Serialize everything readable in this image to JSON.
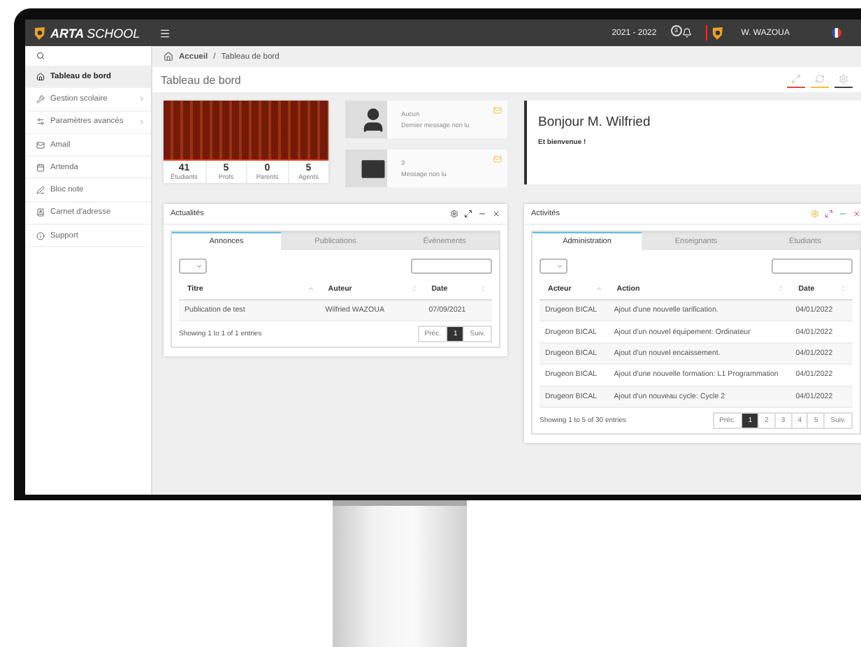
{
  "topbar": {
    "logo_bold": "ARTA",
    "logo_light": "SCHOOL",
    "year": "2021 - 2022",
    "notifications": "3",
    "user": "W. WAZOUA"
  },
  "sidebar": {
    "items": [
      {
        "kind": "home",
        "label": "Tableau de bord",
        "selected": true,
        "has_children": false
      },
      {
        "kind": "wrench",
        "label": "Gestion scolaire",
        "selected": false,
        "has_children": true
      },
      {
        "kind": "cogs",
        "label": "Paramètres avancés",
        "selected": false,
        "has_children": true
      },
      {
        "kind": "mail",
        "label": "Amail",
        "selected": false,
        "has_children": false
      },
      {
        "kind": "calendar",
        "label": "Artenda",
        "selected": false,
        "has_children": false
      },
      {
        "kind": "pen",
        "label": "Bloc note",
        "selected": false,
        "has_children": false
      },
      {
        "kind": "book",
        "label": "Carnet d'adresse",
        "selected": false,
        "has_children": false
      },
      {
        "kind": "info",
        "label": "Support",
        "selected": false,
        "has_children": false
      }
    ]
  },
  "breadcrumb": {
    "items": [
      "Accueil",
      "Tableau de bord"
    ],
    "separator": "/"
  },
  "page_title": "Tableau de bord",
  "stats": [
    {
      "value": "41",
      "label": "Étudiants"
    },
    {
      "value": "5",
      "label": "Profs"
    },
    {
      "value": "0",
      "label": "Parents"
    },
    {
      "value": "5",
      "label": "Agents"
    }
  ],
  "messages": [
    {
      "kind": "user",
      "value": "Aucun",
      "caption": "Dernier message non lu"
    },
    {
      "kind": "mail",
      "value": "3",
      "caption": "Message non lu"
    }
  ],
  "welcome": {
    "title": "Bonjour M. Wilfried",
    "text": "Et bienvenue !"
  },
  "panels": [
    {
      "title": "Actualités",
      "colored_icons": false,
      "tabs": [
        {
          "label": "Annonces",
          "selected": true
        },
        {
          "label": "Publications",
          "selected": false
        },
        {
          "label": "Évènements",
          "selected": false
        }
      ],
      "columns": [
        {
          "label": "Titre",
          "sorted": true
        },
        {
          "label": "Auteur",
          "sorted": false
        },
        {
          "label": "Date",
          "sorted": false
        }
      ],
      "rows": [
        [
          "Publication de test",
          "Wilfried WAZOUA",
          "07/09/2021"
        ]
      ],
      "info": "Showing 1 to 1 of 1 entries",
      "prev": "Préc.",
      "next": "Suiv.",
      "pages": [
        {
          "label": "1",
          "selected": true
        }
      ]
    },
    {
      "title": "Activités",
      "colored_icons": true,
      "tabs": [
        {
          "label": "Administration",
          "selected": true
        },
        {
          "label": "Enseignants",
          "selected": false
        },
        {
          "label": "Étudiants",
          "selected": false
        }
      ],
      "columns": [
        {
          "label": "Acteur",
          "sorted": true
        },
        {
          "label": "Action",
          "sorted": false
        },
        {
          "label": "Date",
          "sorted": false
        }
      ],
      "rows": [
        [
          "Drugeon BICAL",
          "Ajout d'une nouvelle tarification.",
          "04/01/2022"
        ],
        [
          "Drugeon BICAL",
          "Ajout d'un nouvel équipement: Ordinateur",
          "04/01/2022"
        ],
        [
          "Drugeon BICAL",
          "Ajout d'un nouvel encaissement.",
          "04/01/2022"
        ],
        [
          "Drugeon BICAL",
          "Ajout d'une nouvelle formation: L1 Programmation",
          "04/01/2022"
        ],
        [
          "Drugeon BICAL",
          "Ajout d'un nouveau cycle: Cycle 2",
          "04/01/2022"
        ]
      ],
      "info": "Showing 1 to 5 of 30 entries",
      "prev": "Préc.",
      "next": "Suiv.",
      "pages": [
        {
          "label": "1",
          "selected": true
        },
        {
          "label": "2",
          "selected": false
        },
        {
          "label": "3",
          "selected": false
        },
        {
          "label": "4",
          "selected": false
        },
        {
          "label": "5",
          "selected": false
        }
      ]
    }
  ]
}
